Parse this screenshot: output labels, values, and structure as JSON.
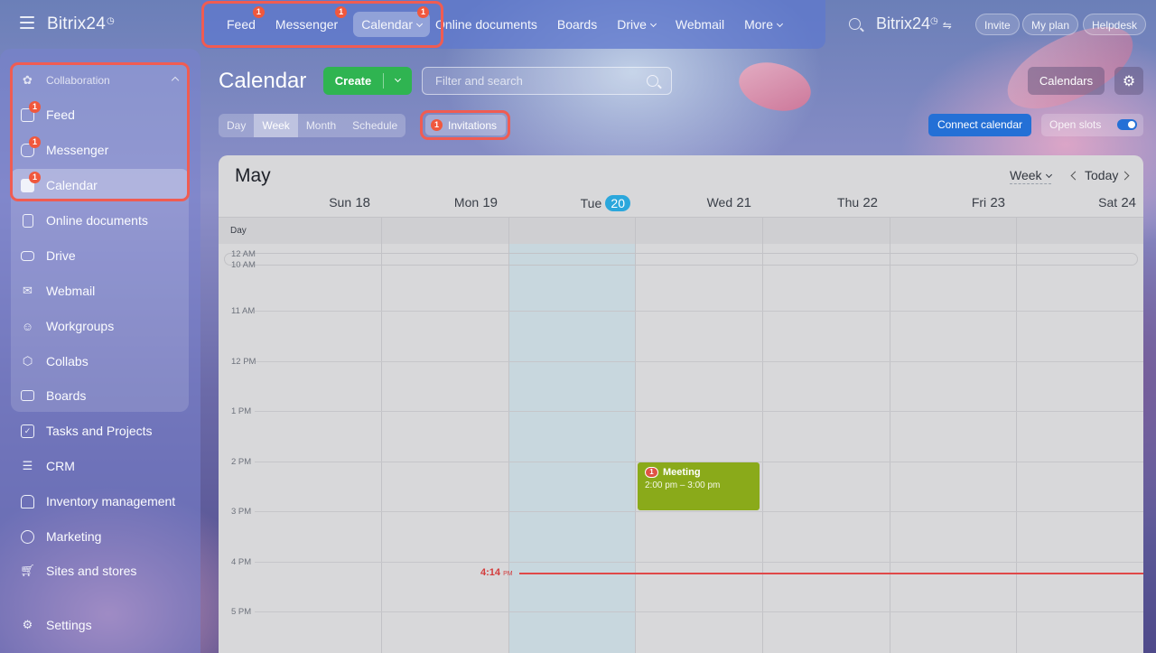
{
  "app": {
    "logo": "Bitrix24"
  },
  "topnav": {
    "items": [
      {
        "label": "Feed",
        "badge": "1"
      },
      {
        "label": "Messenger",
        "badge": "1"
      },
      {
        "label": "Calendar",
        "badge": "1"
      },
      {
        "label": "Online documents"
      },
      {
        "label": "Boards"
      },
      {
        "label": "Drive"
      },
      {
        "label": "Webmail"
      },
      {
        "label": "More"
      }
    ],
    "brand": "Bitrix24",
    "invite": "Invite",
    "my_plan": "My plan",
    "helpdesk": "Helpdesk"
  },
  "sidebar": {
    "group_title": "Collaboration",
    "items": [
      {
        "label": "Feed",
        "badge": "1",
        "icon": "feed-icon"
      },
      {
        "label": "Messenger",
        "badge": "1",
        "icon": "messenger-icon"
      },
      {
        "label": "Calendar",
        "badge": "1",
        "icon": "calendar-icon"
      },
      {
        "label": "Online documents",
        "icon": "document-icon"
      },
      {
        "label": "Drive",
        "icon": "drive-icon"
      },
      {
        "label": "Webmail",
        "icon": "mail-icon"
      },
      {
        "label": "Workgroups",
        "icon": "workgroups-icon"
      },
      {
        "label": "Collabs",
        "icon": "collabs-icon"
      },
      {
        "label": "Boards",
        "icon": "boards-icon"
      },
      {
        "label": "Tasks and Projects",
        "icon": "tasks-icon"
      },
      {
        "label": "CRM",
        "icon": "crm-icon"
      },
      {
        "label": "Inventory management",
        "icon": "inventory-icon"
      },
      {
        "label": "Marketing",
        "icon": "marketing-icon"
      },
      {
        "label": "Sites and stores",
        "icon": "cart-icon"
      },
      {
        "label": "Settings",
        "icon": "gear-icon"
      }
    ]
  },
  "toolbar": {
    "title": "Calendar",
    "create": "Create",
    "filter_placeholder": "Filter and search",
    "calendars": "Calendars",
    "views": [
      "Day",
      "Week",
      "Month",
      "Schedule"
    ],
    "active_view": "Week",
    "invitations": "Invitations",
    "invitations_badge": "1",
    "connect_calendar": "Connect calendar",
    "open_slots": "Open slots",
    "open_slots_on": true
  },
  "calendar": {
    "month": "May",
    "view_select": "Week",
    "today_label": "Today",
    "days": [
      {
        "dow": "Sun",
        "num": "18"
      },
      {
        "dow": "Mon",
        "num": "19"
      },
      {
        "dow": "Tue",
        "num": "20",
        "today": true
      },
      {
        "dow": "Wed",
        "num": "21"
      },
      {
        "dow": "Thu",
        "num": "22"
      },
      {
        "dow": "Fri",
        "num": "23"
      },
      {
        "dow": "Sat",
        "num": "24"
      }
    ],
    "allday_label": "Day",
    "hours": [
      "12 AM",
      "10 AM",
      "11 AM",
      "12 PM",
      "1 PM",
      "2 PM",
      "3 PM",
      "4 PM",
      "5 PM"
    ],
    "now_time": "4:14",
    "now_suffix": "PM",
    "event": {
      "title": "Meeting",
      "time": "2:00 pm – 3:00 pm",
      "badge": "1",
      "color": "#8aaa1a"
    }
  },
  "colors": {
    "accent_green": "#2fb451",
    "accent_blue": "#2470d6",
    "today": "#2ba7dc",
    "now_line": "#e04848",
    "badge": "#f0583d"
  }
}
